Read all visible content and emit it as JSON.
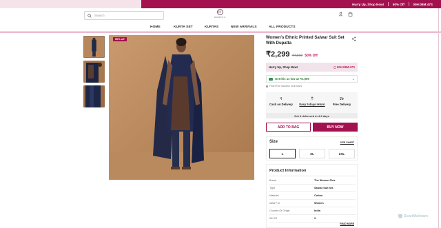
{
  "promo": {
    "text": "Hurry Up, Shop Now!",
    "offer": "50% Off",
    "timer": "00H:08M:47S"
  },
  "header": {
    "search_placeholder": "Search",
    "logo_mark": "W",
    "logo_text": "WOMEN'S"
  },
  "nav": {
    "items": [
      "HOME",
      "KURTA SET",
      "KURTAS",
      "NEW ARRIVALS",
      "ALL PRODUCTS"
    ]
  },
  "gallery": {
    "badge": "50% off"
  },
  "product": {
    "title": "Women's Ethnic Printed Salwar Suit Set With Dupatta",
    "price": "₹2,299",
    "mrp": "₹4,599",
    "discount": "50% Off"
  },
  "hurry": {
    "label": "Hurry Up, Shop Now!",
    "timer": "00H:08M:47S"
  },
  "offer": {
    "text": "Get this as low as ₹1,999",
    "tax_note": "Final Price inclusive of all taxes"
  },
  "services": [
    {
      "label": "Cash on Delivery"
    },
    {
      "label": "Easy 5 days return"
    },
    {
      "label": "Free Delivery"
    }
  ],
  "delivery_text": "Get it delivered in 4-9 days",
  "buttons": {
    "add_to_bag": "ADD TO BAG",
    "buy_now": "BUY NOW"
  },
  "size": {
    "title": "Size",
    "chart_link": "SIZE CHART",
    "options": [
      "L",
      "XL",
      "2XL"
    ],
    "selected": "L"
  },
  "product_info": {
    "title": "Product Information",
    "rows": [
      {
        "key": "Brand",
        "value": "The Women Plus"
      },
      {
        "key": "Type",
        "value": "Salwar Suit Set"
      },
      {
        "key": "Material",
        "value": "Cotton"
      },
      {
        "key": "Ideal For",
        "value": "Women"
      },
      {
        "key": "Country Of Origin",
        "value": "India"
      },
      {
        "key": "Set Of",
        "value": "3"
      }
    ],
    "read_more": "READ MORE"
  },
  "watermark": "ScanMalware",
  "colors": {
    "brand": "#a3124f",
    "promo_bg": "#f6e3ea",
    "offer_green": "#2e7d32"
  }
}
